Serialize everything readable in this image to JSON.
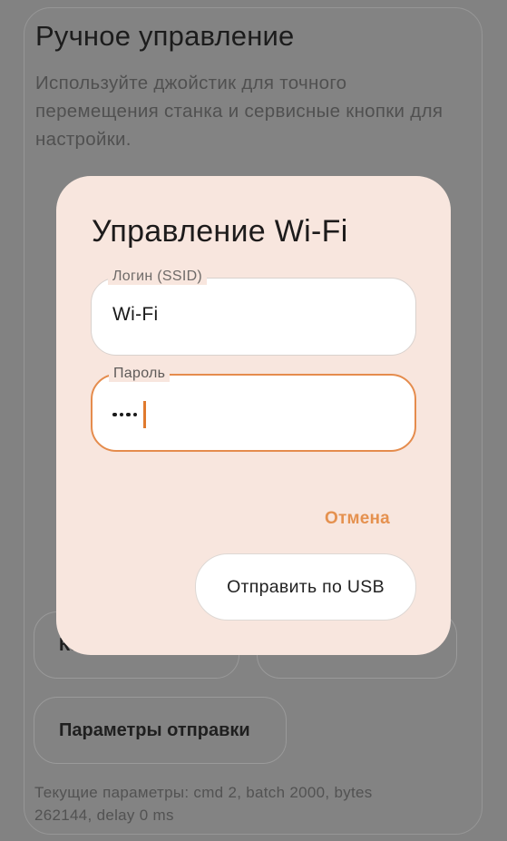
{
  "background": {
    "title": "Ручное управление",
    "description": "Используйте джойстик для точного перемещения станка и сервисные кнопки для настройки.",
    "buttons": {
      "left_label": "Ка",
      "right_label": "",
      "params_label": "Параметры отправки"
    },
    "footer": "Текущие параметры: cmd 2, batch 2000, bytes 262144, delay 0 ms"
  },
  "dialog": {
    "title": "Управление Wi-Fi",
    "ssid": {
      "label": "Логин (SSID)",
      "value": "Wi-Fi"
    },
    "password": {
      "label": "Пароль",
      "masked_length": 4
    },
    "cancel_label": "Отмена",
    "submit_label": "Отправить по USB"
  },
  "colors": {
    "accent": "#e58c4d",
    "dialog_bg": "#f8e6de",
    "scrim": "#828282"
  }
}
